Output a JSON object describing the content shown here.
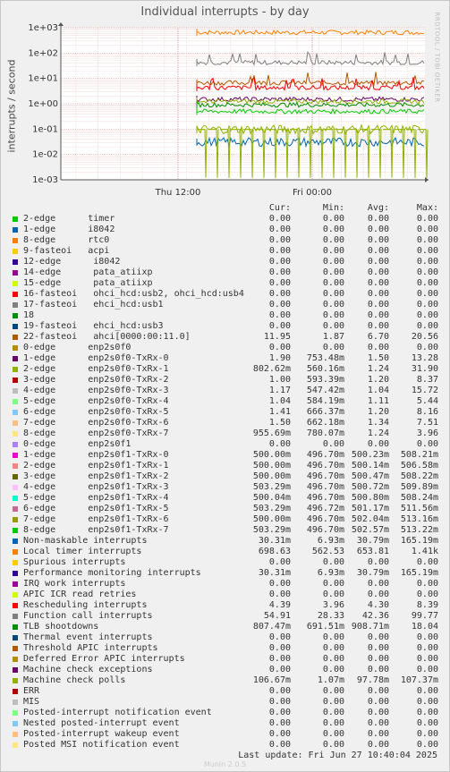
{
  "title": "Individual interrupts - by day",
  "vertical_label": "interrupts / second",
  "side_label": "RRDTOOL / TOBI OETIKER",
  "columns": {
    "cur": "Cur:",
    "min": "Min:",
    "avg": "Avg:",
    "max": "Max:"
  },
  "rows": [
    {
      "label": "2-edge      timer",
      "color": "#00cc00",
      "cur": "0.00",
      "min": "0.00",
      "avg": "0.00",
      "max": "0.00"
    },
    {
      "label": "1-edge      i8042",
      "color": "#0066b3",
      "cur": "0.00",
      "min": "0.00",
      "avg": "0.00",
      "max": "0.00"
    },
    {
      "label": "8-edge      rtc0",
      "color": "#ff8000",
      "cur": "0.00",
      "min": "0.00",
      "avg": "0.00",
      "max": "0.00"
    },
    {
      "label": "9-fasteoi   acpi",
      "color": "#ffcc00",
      "cur": "0.00",
      "min": "0.00",
      "avg": "0.00",
      "max": "0.00"
    },
    {
      "label": "12-edge      i8042",
      "color": "#330099",
      "cur": "0.00",
      "min": "0.00",
      "avg": "0.00",
      "max": "0.00"
    },
    {
      "label": "14-edge      pata_atiixp",
      "color": "#990099",
      "cur": "0.00",
      "min": "0.00",
      "avg": "0.00",
      "max": "0.00"
    },
    {
      "label": "15-edge      pata_atiixp",
      "color": "#ccff00",
      "cur": "0.00",
      "min": "0.00",
      "avg": "0.00",
      "max": "0.00"
    },
    {
      "label": "16-fasteoi   ohci_hcd:usb2, ohci_hcd:usb4",
      "color": "#ff0000",
      "cur": "0.00",
      "min": "0.00",
      "avg": "0.00",
      "max": "0.00"
    },
    {
      "label": "17-fasteoi   ehci_hcd:usb1",
      "color": "#808080",
      "cur": "0.00",
      "min": "0.00",
      "avg": "0.00",
      "max": "0.00"
    },
    {
      "label": "18",
      "color": "#008f00",
      "cur": "0.00",
      "min": "0.00",
      "avg": "0.00",
      "max": "0.00"
    },
    {
      "label": "19-fasteoi   ehci_hcd:usb3",
      "color": "#00487d",
      "cur": "0.00",
      "min": "0.00",
      "avg": "0.00",
      "max": "0.00"
    },
    {
      "label": "22-fasteoi   ahci[0000:00:11.0]",
      "color": "#b35a00",
      "cur": "11.95",
      "min": "1.87",
      "avg": "6.70",
      "max": "20.56"
    },
    {
      "label": "0-edge      enp2s0f0",
      "color": "#b38f00",
      "cur": "0.00",
      "min": "0.00",
      "avg": "0.00",
      "max": "0.00"
    },
    {
      "label": "1-edge      enp2s0f0-TxRx-0",
      "color": "#6b006b",
      "cur": "1.90",
      "min": "753.48m",
      "avg": "1.50",
      "max": "13.28"
    },
    {
      "label": "2-edge      enp2s0f0-TxRx-1",
      "color": "#8fb300",
      "cur": "802.62m",
      "min": "560.16m",
      "avg": "1.24",
      "max": "31.90"
    },
    {
      "label": "3-edge      enp2s0f0-TxRx-2",
      "color": "#b30000",
      "cur": "1.00",
      "min": "593.39m",
      "avg": "1.20",
      "max": "8.37"
    },
    {
      "label": "4-edge      enp2s0f0-TxRx-3",
      "color": "#bebebe",
      "cur": "1.17",
      "min": "547.42m",
      "avg": "1.04",
      "max": "15.72"
    },
    {
      "label": "5-edge      enp2s0f0-TxRx-4",
      "color": "#80ff80",
      "cur": "1.04",
      "min": "584.19m",
      "avg": "1.11",
      "max": "5.44"
    },
    {
      "label": "6-edge      enp2s0f0-TxRx-5",
      "color": "#80c9ff",
      "cur": "1.41",
      "min": "666.37m",
      "avg": "1.20",
      "max": "8.16"
    },
    {
      "label": "7-edge      enp2s0f0-TxRx-6",
      "color": "#ffc080",
      "cur": "1.50",
      "min": "662.18m",
      "avg": "1.34",
      "max": "7.51"
    },
    {
      "label": "8-edge      enp2s0f0-TxRx-7",
      "color": "#ffe680",
      "cur": "955.69m",
      "min": "780.07m",
      "avg": "1.24",
      "max": "3.96"
    },
    {
      "label": "0-edge      enp2s0f1",
      "color": "#aa80ff",
      "cur": "0.00",
      "min": "0.00",
      "avg": "0.00",
      "max": "0.00"
    },
    {
      "label": "1-edge      enp2s0f1-TxRx-0",
      "color": "#ee00cc",
      "cur": "500.00m",
      "min": "496.70m",
      "avg": "500.23m",
      "max": "508.21m"
    },
    {
      "label": "2-edge      enp2s0f1-TxRx-1",
      "color": "#ff8080",
      "cur": "500.00m",
      "min": "496.70m",
      "avg": "500.14m",
      "max": "506.58m"
    },
    {
      "label": "3-edge      enp2s0f1-TxRx-2",
      "color": "#666600",
      "cur": "500.00m",
      "min": "496.70m",
      "avg": "500.47m",
      "max": "508.22m"
    },
    {
      "label": "4-edge      enp2s0f1-TxRx-3",
      "color": "#ffbfff",
      "cur": "503.29m",
      "min": "496.70m",
      "avg": "500.72m",
      "max": "509.89m"
    },
    {
      "label": "5-edge      enp2s0f1-TxRx-4",
      "color": "#00ffcc",
      "cur": "500.04m",
      "min": "496.70m",
      "avg": "500.80m",
      "max": "508.24m"
    },
    {
      "label": "6-edge      enp2s0f1-TxRx-5",
      "color": "#cc6699",
      "cur": "503.29m",
      "min": "496.72m",
      "avg": "501.17m",
      "max": "511.56m"
    },
    {
      "label": "7-edge      enp2s0f1-TxRx-6",
      "color": "#999900",
      "cur": "500.00m",
      "min": "496.70m",
      "avg": "502.04m",
      "max": "513.16m"
    },
    {
      "label": "8-edge      enp2s0f1-TxRx-7",
      "color": "#00cc00",
      "cur": "503.29m",
      "min": "496.70m",
      "avg": "502.57m",
      "max": "513.22m"
    },
    {
      "label": "Non-maskable interrupts",
      "color": "#0066b3",
      "cur": "30.31m",
      "min": "6.93m",
      "avg": "30.79m",
      "max": "165.19m"
    },
    {
      "label": "Local timer interrupts",
      "color": "#ff8000",
      "cur": "698.63",
      "min": "562.53",
      "avg": "653.81",
      "max": "1.41k"
    },
    {
      "label": "Spurious interrupts",
      "color": "#ffcc00",
      "cur": "0.00",
      "min": "0.00",
      "avg": "0.00",
      "max": "0.00"
    },
    {
      "label": "Performance monitoring interrupts",
      "color": "#330099",
      "cur": "30.31m",
      "min": "6.93m",
      "avg": "30.79m",
      "max": "165.19m"
    },
    {
      "label": "IRQ work interrupts",
      "color": "#990099",
      "cur": "0.00",
      "min": "0.00",
      "avg": "0.00",
      "max": "0.00"
    },
    {
      "label": "APIC ICR read retries",
      "color": "#ccff00",
      "cur": "0.00",
      "min": "0.00",
      "avg": "0.00",
      "max": "0.00"
    },
    {
      "label": "Rescheduling interrupts",
      "color": "#ff0000",
      "cur": "4.39",
      "min": "3.96",
      "avg": "4.30",
      "max": "8.39"
    },
    {
      "label": "Function call interrupts",
      "color": "#808080",
      "cur": "54.91",
      "min": "28.33",
      "avg": "42.36",
      "max": "99.77"
    },
    {
      "label": "TLB shootdowns",
      "color": "#008f00",
      "cur": "807.47m",
      "min": "691.51m",
      "avg": "908.71m",
      "max": "18.04"
    },
    {
      "label": "Thermal event interrupts",
      "color": "#00487d",
      "cur": "0.00",
      "min": "0.00",
      "avg": "0.00",
      "max": "0.00"
    },
    {
      "label": "Threshold APIC interrupts",
      "color": "#b35a00",
      "cur": "0.00",
      "min": "0.00",
      "avg": "0.00",
      "max": "0.00"
    },
    {
      "label": "Deferred Error APIC interrupts",
      "color": "#b38f00",
      "cur": "0.00",
      "min": "0.00",
      "avg": "0.00",
      "max": "0.00"
    },
    {
      "label": "Machine check exceptions",
      "color": "#6b006b",
      "cur": "0.00",
      "min": "0.00",
      "avg": "0.00",
      "max": "0.00"
    },
    {
      "label": "Machine check polls",
      "color": "#8fb300",
      "cur": "106.67m",
      "min": "1.07m",
      "avg": "97.78m",
      "max": "107.37m"
    },
    {
      "label": "ERR",
      "color": "#b30000",
      "cur": "0.00",
      "min": "0.00",
      "avg": "0.00",
      "max": "0.00"
    },
    {
      "label": "MIS",
      "color": "#bebebe",
      "cur": "0.00",
      "min": "0.00",
      "avg": "0.00",
      "max": "0.00"
    },
    {
      "label": "Posted-interrupt notification event",
      "color": "#80ff80",
      "cur": "0.00",
      "min": "0.00",
      "avg": "0.00",
      "max": "0.00"
    },
    {
      "label": "Nested posted-interrupt event",
      "color": "#80c9ff",
      "cur": "0.00",
      "min": "0.00",
      "avg": "0.00",
      "max": "0.00"
    },
    {
      "label": "Posted-interrupt wakeup event",
      "color": "#ffc080",
      "cur": "0.00",
      "min": "0.00",
      "avg": "0.00",
      "max": "0.00"
    },
    {
      "label": "Posted MSI notification event",
      "color": "#ffe680",
      "cur": "0.00",
      "min": "0.00",
      "avg": "0.00",
      "max": "0.00"
    }
  ],
  "footer": "Last update: Fri Jun 27 10:40:04 2025",
  "watermark": "Munin 2.0.5",
  "chart_data": {
    "type": "line",
    "title": "Individual interrupts - by day",
    "ylabel": "interrupts / second",
    "yscale": "log",
    "ylim": [
      0.001,
      1000
    ],
    "yticks": [
      "1e+03",
      "1e+02",
      "1e+01",
      "1e+00",
      "1e-01",
      "1e-02",
      "1e-03"
    ],
    "xticks": [
      "Thu 12:00",
      "Fri 00:00"
    ],
    "grid": true,
    "series_levels": [
      {
        "name": "Local timer interrupts",
        "color": "#ff8000",
        "level": 653.81
      },
      {
        "name": "Function call interrupts",
        "color": "#808080",
        "level": 42.36
      },
      {
        "name": "22-fasteoi   ahci[0000:00:11.0]",
        "color": "#b35a00",
        "level": 6.7
      },
      {
        "name": "Rescheduling interrupts",
        "color": "#ff0000",
        "level": 4.3
      },
      {
        "name": "1-edge      enp2s0f0-TxRx-0",
        "color": "#6b006b",
        "level": 1.5
      },
      {
        "name": "2-edge      enp2s0f0-TxRx-1",
        "color": "#8fb300",
        "level": 1.24
      },
      {
        "name": "TLB shootdowns",
        "color": "#008f00",
        "level": 0.91
      },
      {
        "name": "8-edge      enp2s0f1-TxRx-7",
        "color": "#00cc00",
        "level": 0.5
      },
      {
        "name": "Machine check polls",
        "color": "#8fb300",
        "level": 0.0978
      },
      {
        "name": "Non-maskable interrupts",
        "color": "#0066b3",
        "level": 0.0308
      }
    ]
  }
}
